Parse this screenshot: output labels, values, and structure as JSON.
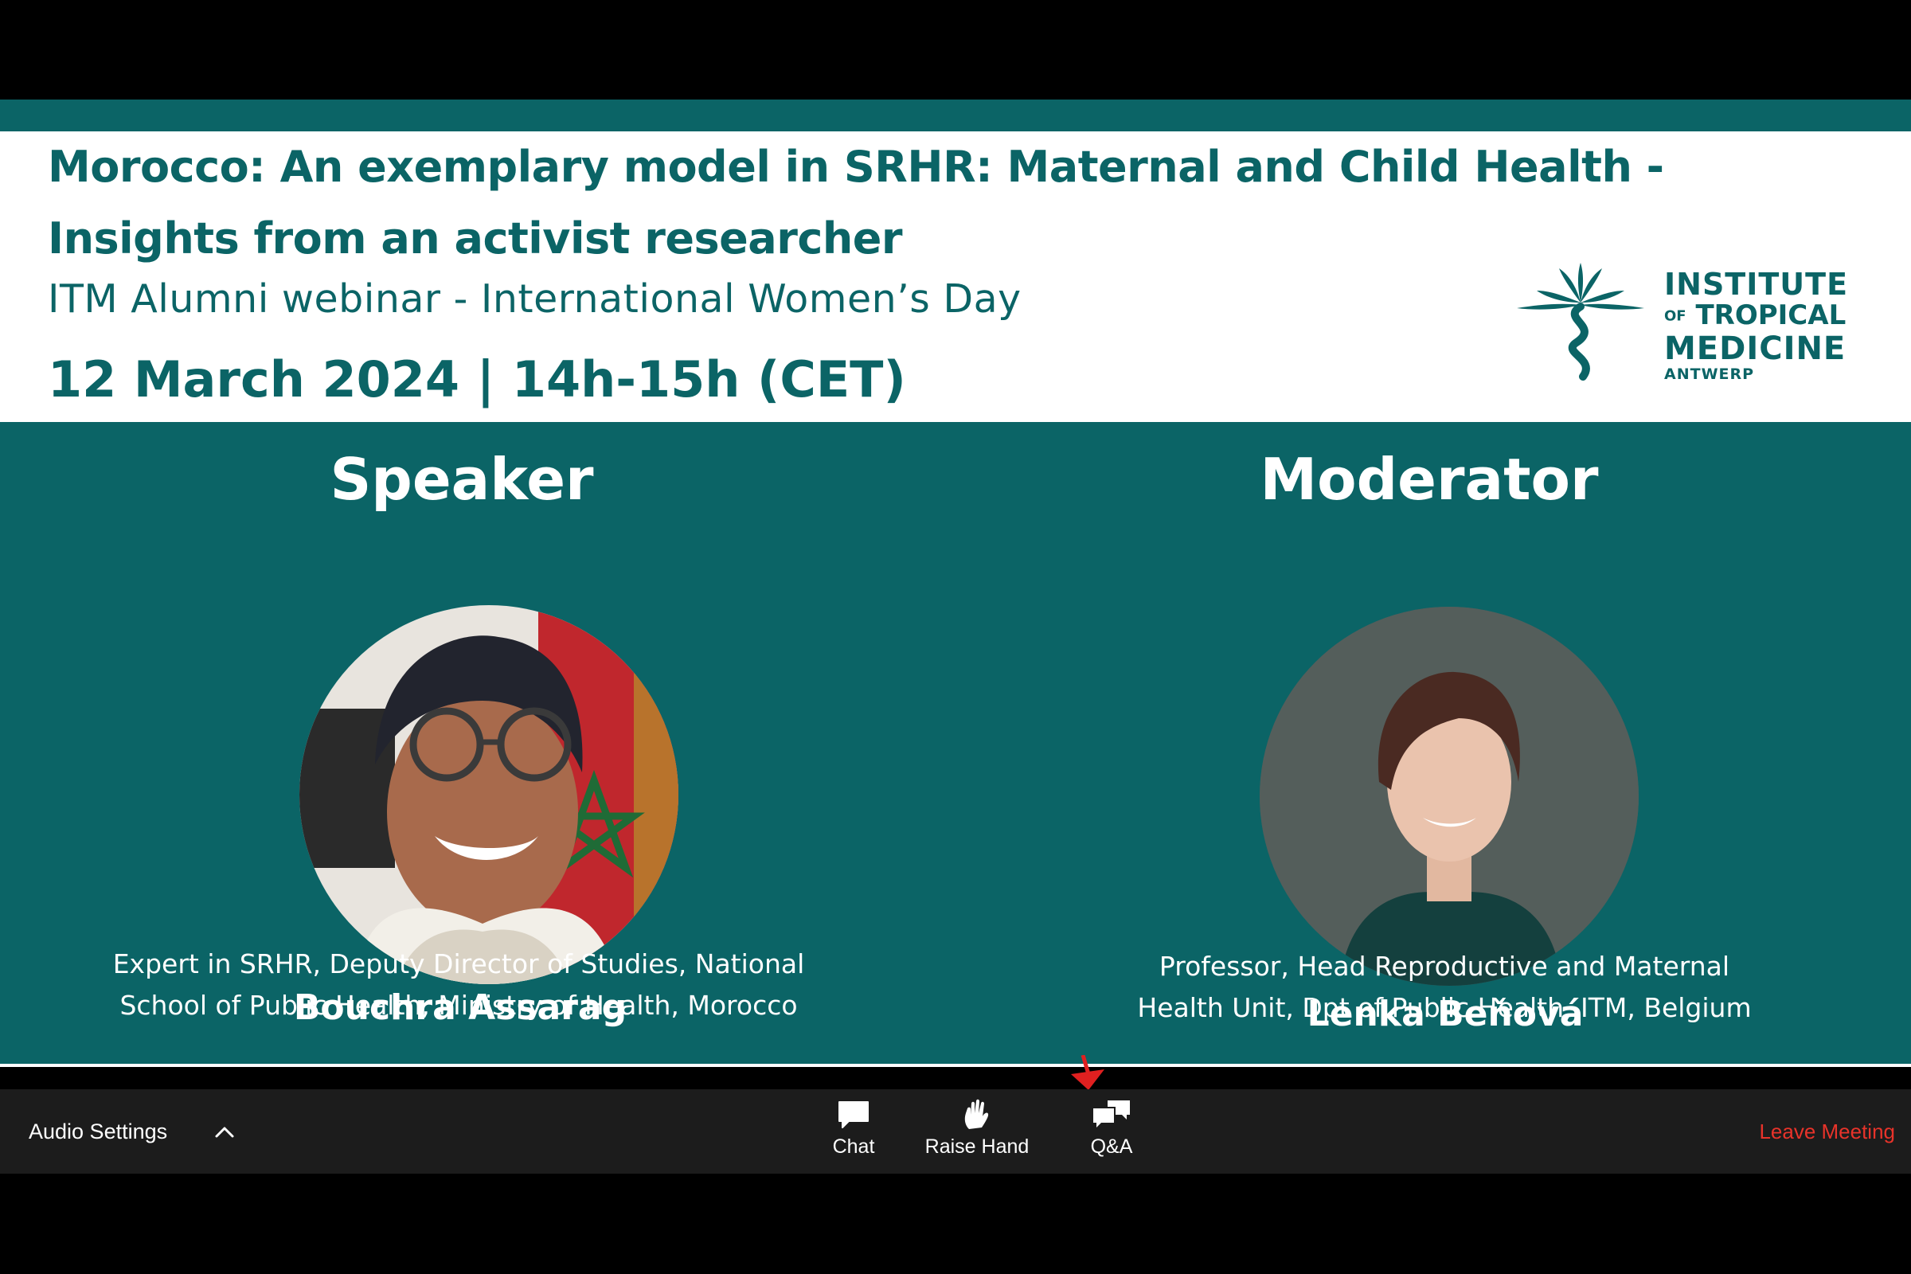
{
  "slide": {
    "title": "Morocco: An exemplary model in SRHR: Maternal and Child Health - Insights from an activist researcher",
    "subtitle": "ITM Alumni webinar - International Women’s Day",
    "date": "12 March 2024 | 14h-15h (CET)",
    "logo": {
      "line1": "INSTITUTE",
      "line2_prefix": "OF",
      "line2": "TROPICAL",
      "line3": "MEDICINE",
      "line4": "ANTWERP"
    },
    "speaker": {
      "role": "Speaker",
      "name": "Bouchra Assarag",
      "desc_line1": "Expert in SRHR, Deputy Director of Studies, National",
      "desc_line2": "School of Public Health, Ministry of Health, Morocco"
    },
    "moderator": {
      "role": "Moderator",
      "name": "Lenka Beňová",
      "desc_line1": "Professor, Head Reproductive and Maternal",
      "desc_line2": "Health Unit, Dpt of Public Health, ITM, Belgium"
    },
    "colors": {
      "brand": "#0b6466",
      "text_light": "#ffffff"
    }
  },
  "toolbar": {
    "audio_settings": "Audio Settings",
    "chat": "Chat",
    "raise_hand": "Raise Hand",
    "qa": "Q&A",
    "leave": "Leave Meeting",
    "icons": [
      "caret-up-icon",
      "chat-bubble-icon",
      "raised-hand-icon",
      "qa-bubbles-icon"
    ],
    "colors": {
      "background": "#1c1c1c",
      "leave": "#e8332a"
    }
  }
}
